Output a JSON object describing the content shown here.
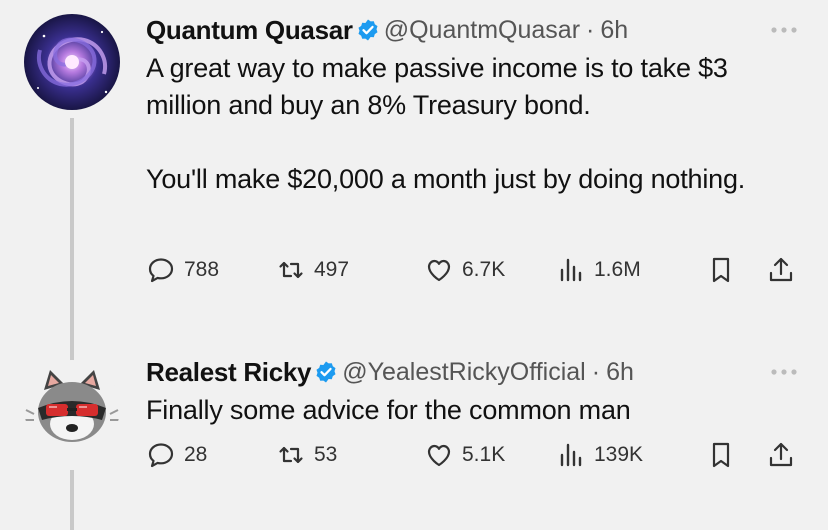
{
  "tweets": [
    {
      "display_name": "Quantum Quasar",
      "handle": "@QuantmQuasar",
      "separator": "·",
      "time": "6h",
      "text_p1": "A great way to make passive income is to take $3 million and buy an 8% Treasury bond.",
      "text_p2": "You'll make $20,000 a month just by doing nothing.",
      "metrics": {
        "replies": "788",
        "retweets": "497",
        "likes": "6.7K",
        "views": "1.6M"
      },
      "avatar_icon": "galaxy-avatar"
    },
    {
      "display_name": "Realest Ricky",
      "handle": "@YealestRickyOfficial",
      "separator": "·",
      "time": "6h",
      "text_p1": "Finally some advice for the common man",
      "metrics": {
        "replies": "28",
        "retweets": "53",
        "likes": "5.1K",
        "views": "139K"
      },
      "avatar_icon": "raccoon-sunglasses-avatar"
    }
  ],
  "colors": {
    "verified": "#1d9bf0",
    "background": "#f1f1f1",
    "text": "#111111",
    "muted": "#555555"
  }
}
